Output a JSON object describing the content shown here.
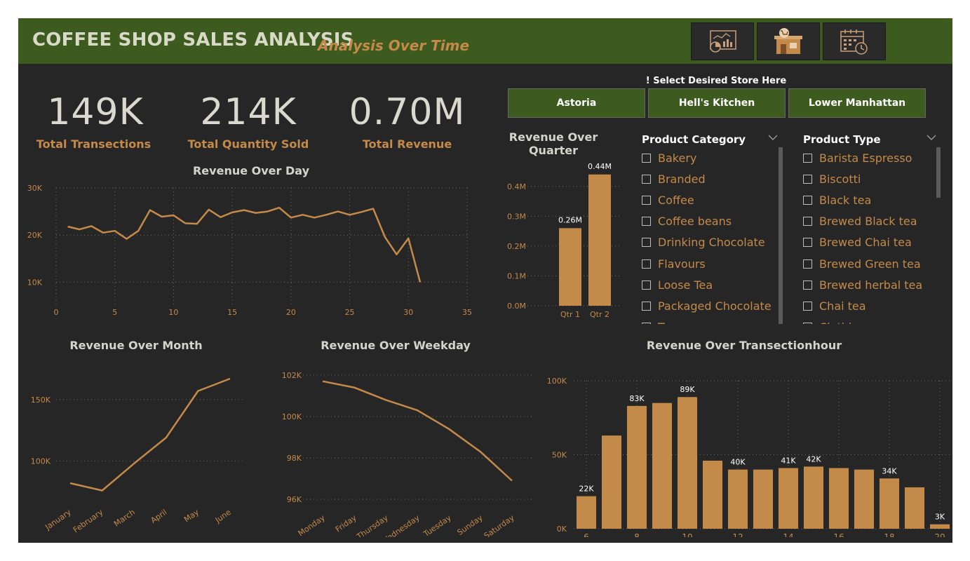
{
  "header": {
    "title": "COFFEE SHOP SALES ANALYSIS",
    "subtitle": "Analysis Over Time",
    "nav_icons": [
      "dashboard-analytics-icon",
      "store-cart-icon",
      "calendar-clock-icon"
    ],
    "bg_color": "#3d5a1f"
  },
  "kpis": [
    {
      "value": "149K",
      "label": "Total Transections"
    },
    {
      "value": "214K",
      "label": "Total Quantity Sold"
    },
    {
      "value": "0.70M",
      "label": "Total Revenue"
    }
  ],
  "store_selector": {
    "label": "! Select Desired Store Here",
    "stores": [
      "Astoria",
      "Hell's Kitchen",
      "Lower Manhattan"
    ]
  },
  "slicers": {
    "category": {
      "header": "Product Category",
      "items": [
        "Bakery",
        "Branded",
        "Coffee",
        "Coffee beans",
        "Drinking Chocolate",
        "Flavours",
        "Loose Tea",
        "Packaged Chocolate",
        "Tea"
      ]
    },
    "type": {
      "header": "Product Type",
      "items": [
        "Barista Espresso",
        "Biscotti",
        "Black tea",
        "Brewed Black tea",
        "Brewed Chai tea",
        "Brewed Green tea",
        "Brewed herbal tea",
        "Chai tea",
        "Clothing"
      ]
    }
  },
  "colors": {
    "accent": "#c48a4a",
    "background": "#262626",
    "grid": "#6e6e6e",
    "axis_text": "#c48a4a",
    "bar_label": "#ffffff"
  },
  "chart_data": [
    {
      "id": "day",
      "type": "line",
      "title": "Revenue Over Day",
      "x": [
        1,
        2,
        3,
        4,
        5,
        6,
        7,
        8,
        9,
        10,
        11,
        12,
        13,
        14,
        15,
        16,
        17,
        18,
        19,
        20,
        21,
        22,
        23,
        24,
        25,
        26,
        27,
        28,
        29,
        30,
        31
      ],
      "values": [
        21800,
        21200,
        21900,
        20500,
        20900,
        19200,
        20900,
        25300,
        23900,
        24200,
        22500,
        22400,
        25400,
        23800,
        24800,
        25300,
        24700,
        25000,
        25800,
        23700,
        24300,
        23700,
        24300,
        25000,
        24300,
        24900,
        25600,
        19600,
        15900,
        19300,
        10000
      ],
      "xlim": [
        0,
        35
      ],
      "ylim": [
        5000,
        30000
      ],
      "xticks": [
        0,
        5,
        10,
        15,
        20,
        25,
        30,
        35
      ],
      "yticks": [
        {
          "v": 30000,
          "label": "30K"
        },
        {
          "v": 20000,
          "label": "20K"
        },
        {
          "v": 10000,
          "label": "10K"
        }
      ],
      "grid": true
    },
    {
      "id": "quarter",
      "type": "bar",
      "title": "Revenue Over Quarter",
      "categories": [
        "Qtr 1",
        "Qtr 2"
      ],
      "values": [
        0.26,
        0.44
      ],
      "data_labels": [
        "0.26M",
        "0.44M"
      ],
      "ylim": [
        0,
        0.47
      ],
      "yticks": [
        {
          "v": 0.0,
          "label": "0.0M"
        },
        {
          "v": 0.1,
          "label": "0.1M"
        },
        {
          "v": 0.2,
          "label": "0.2M"
        },
        {
          "v": 0.3,
          "label": "0.3M"
        },
        {
          "v": 0.4,
          "label": "0.4M"
        }
      ],
      "grid": true
    },
    {
      "id": "month",
      "type": "line",
      "title": "Revenue Over Month",
      "categories": [
        "January",
        "February",
        "March",
        "April",
        "May",
        "June"
      ],
      "values": [
        82000,
        76000,
        98000,
        119000,
        157000,
        167000
      ],
      "ylim": [
        70000,
        175000
      ],
      "yticks": [
        {
          "v": 150000,
          "label": "150K"
        },
        {
          "v": 100000,
          "label": "100K"
        }
      ],
      "grid": true
    },
    {
      "id": "weekday",
      "type": "line",
      "title": "Revenue Over Weekday",
      "categories": [
        "Monday",
        "Friday",
        "Thursday",
        "Wednesday",
        "Tuesday",
        "Sunday",
        "Saturday"
      ],
      "values": [
        101700,
        101400,
        100800,
        100300,
        99400,
        98300,
        96900
      ],
      "ylim": [
        95800,
        102300
      ],
      "yticks": [
        {
          "v": 102000,
          "label": "102K"
        },
        {
          "v": 100000,
          "label": "100K"
        },
        {
          "v": 98000,
          "label": "98K"
        },
        {
          "v": 96000,
          "label": "96K"
        }
      ],
      "grid": true
    },
    {
      "id": "hour",
      "type": "bar",
      "title": "Revenue Over Transectionhour",
      "categories": [
        6,
        7,
        8,
        9,
        10,
        11,
        12,
        13,
        14,
        15,
        16,
        17,
        18,
        19,
        20
      ],
      "values": [
        22000,
        63000,
        83000,
        85000,
        89000,
        46000,
        40000,
        40000,
        41000,
        42000,
        41000,
        40000,
        34000,
        28000,
        3000
      ],
      "data_labels": [
        "22K",
        "",
        "83K",
        "",
        "89K",
        "",
        "40K",
        "",
        "41K",
        "42K",
        "",
        "",
        "34K",
        "",
        "3K"
      ],
      "xticks": [
        6,
        8,
        10,
        12,
        14,
        16,
        18,
        20
      ],
      "ylim": [
        0,
        100000
      ],
      "yticks": [
        {
          "v": 100000,
          "label": "100K"
        },
        {
          "v": 50000,
          "label": "50K"
        },
        {
          "v": 0,
          "label": "0K"
        }
      ],
      "grid": true
    }
  ]
}
